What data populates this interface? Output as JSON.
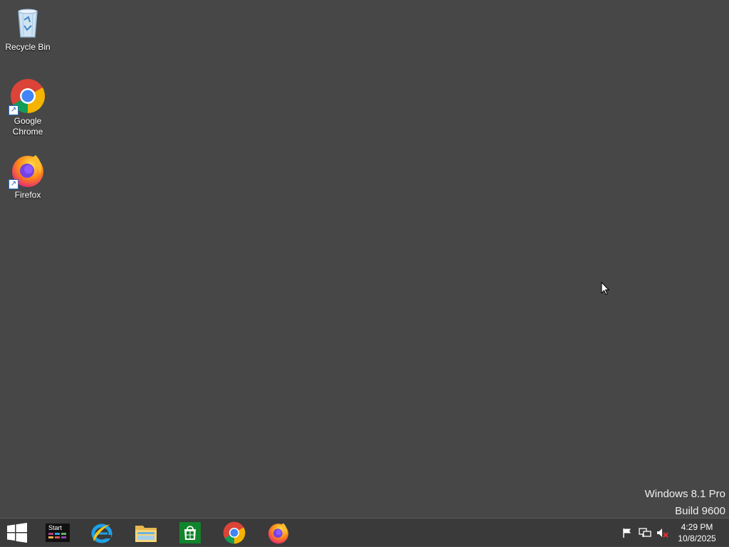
{
  "desktop": {
    "icons": [
      {
        "label": "Recycle Bin",
        "icon": "recycle-bin-icon"
      },
      {
        "label": "Google\nChrome",
        "icon": "chrome-icon",
        "shortcut": true
      },
      {
        "label": "Firefox",
        "icon": "firefox-icon",
        "shortcut": true
      }
    ],
    "watermark": {
      "edition": "Windows 8.1 Pro",
      "build": "Build 9600"
    },
    "background_color": "#474747"
  },
  "taskbar": {
    "start_tile_label": "Start",
    "pinned": [
      {
        "name": "Internet Explorer",
        "icon": "internet-explorer-icon"
      },
      {
        "name": "File Explorer",
        "icon": "file-explorer-icon"
      },
      {
        "name": "Store",
        "icon": "store-icon"
      },
      {
        "name": "Google Chrome",
        "icon": "chrome-icon"
      },
      {
        "name": "Firefox",
        "icon": "firefox-icon"
      }
    ],
    "tray": {
      "icons": [
        "action-center-flag-icon",
        "network-icon",
        "volume-muted-icon"
      ],
      "time": "4:29 PM",
      "date": "10/8/2025"
    }
  }
}
